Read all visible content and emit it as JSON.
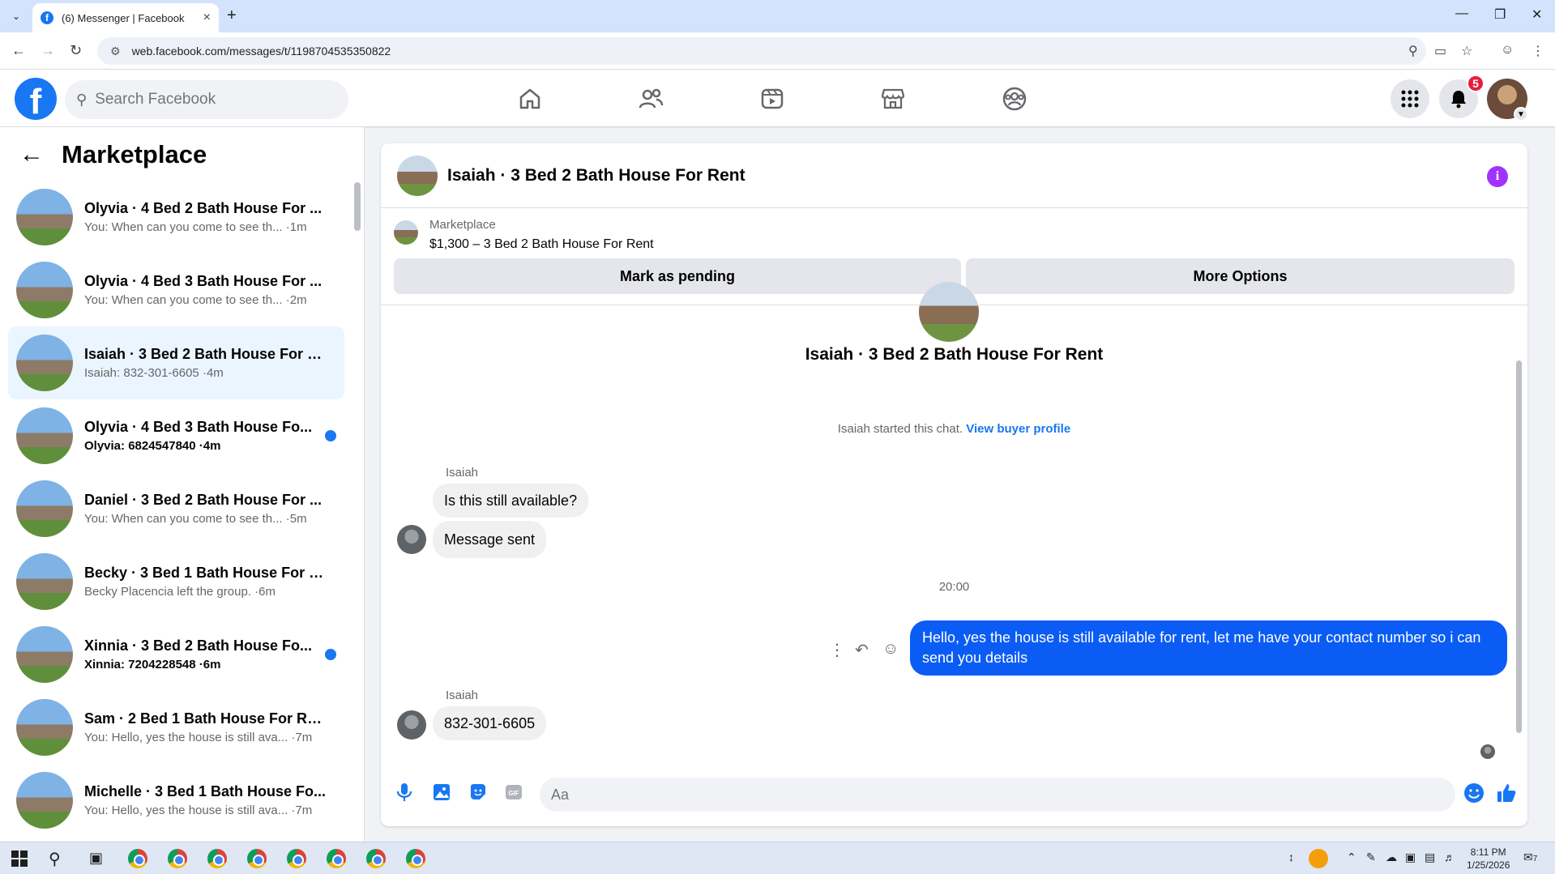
{
  "browser": {
    "tab_title": "(6) Messenger | Facebook",
    "tab_favicon": "f",
    "url": "web.facebook.com/messages/t/1198704535350822",
    "icons": [
      "tab-dropdown-icon",
      "close-tab-icon",
      "new-tab-icon",
      "minimize-icon",
      "restore-icon",
      "close-window-icon",
      "back-icon",
      "forward-icon",
      "reload-icon",
      "site-info-icon",
      "zoom-icon",
      "install-icon",
      "bookmark-star-icon",
      "profile-icon",
      "kebab-menu-icon"
    ]
  },
  "fb_header": {
    "logo": "f",
    "search_placeholder": "Search Facebook",
    "notification_count": "5",
    "nav_icons": [
      "home-icon",
      "friends-icon",
      "video-icon",
      "marketplace-icon",
      "groups-icon"
    ],
    "right_icons": [
      "menu-grid-icon",
      "notifications-bell-icon",
      "account-avatar"
    ]
  },
  "sidebar": {
    "title": "Marketplace",
    "conversations": [
      {
        "name": "Olyvia · 4 Bed 2 Bath House For ...",
        "preview": "You: When can you come to see th... ·1m",
        "unread": false
      },
      {
        "name": "Olyvia · 4 Bed 3 Bath House For ...",
        "preview": "You: When can you come to see th... ·2m",
        "unread": false
      },
      {
        "name": "Isaiah · 3 Bed 2 Bath House For R...",
        "preview": "Isaiah: 832-301-6605 ·4m",
        "unread": false,
        "active": true
      },
      {
        "name": "Olyvia · 4 Bed 3 Bath House Fo...",
        "preview": "Olyvia: 6824547840 ·4m",
        "unread": true
      },
      {
        "name": "Daniel · 3 Bed 2 Bath House For ...",
        "preview": "You: When can you come to see th... ·5m",
        "unread": false
      },
      {
        "name": "Becky · 3 Bed 1 Bath House For R...",
        "preview": "Becky Placencia left the group. ·6m",
        "unread": false
      },
      {
        "name": "Xinnia · 3 Bed 2 Bath House Fo...",
        "preview": "Xinnia: 7204228548 ·6m",
        "unread": true
      },
      {
        "name": "Sam · 2 Bed 1 Bath House For Rent",
        "preview": "You: Hello, yes the house is still ava... ·7m",
        "unread": false
      },
      {
        "name": "Michelle · 3 Bed 1 Bath House Fo...",
        "preview": "You: Hello, yes the house is still ava... ·7m",
        "unread": false
      }
    ]
  },
  "chat": {
    "title": "Isaiah · 3 Bed 2 Bath House For Rent",
    "info_icon": "i",
    "marketplace_label": "Marketplace",
    "listing": "$1,300 – 3 Bed 2 Bath House For Rent",
    "mark_pending": "Mark as pending",
    "more_options": "More Options",
    "top_name": "Isaiah · 3 Bed 2 Bath House For Rent",
    "started_text": "Isaiah started this chat.",
    "view_profile": "View buyer profile",
    "messages": {
      "sender1": "Isaiah",
      "msg1": "Is this still available?",
      "msg2": "Message sent",
      "timestamp": "20:00",
      "outgoing": "Hello, yes the house is still available for rent, let me have your contact number so i can send you  details",
      "sender2": "Isaiah",
      "msg3": "832-301-6605"
    },
    "composer_placeholder": "Aa",
    "composer_icons": [
      "microphone-icon",
      "image-icon",
      "sticker-icon",
      "gif-icon",
      "emoji-icon",
      "thumbs-up-icon"
    ]
  },
  "taskbar": {
    "time": "8:11 PM",
    "date": "1/25/2026",
    "notification_count": "7"
  }
}
